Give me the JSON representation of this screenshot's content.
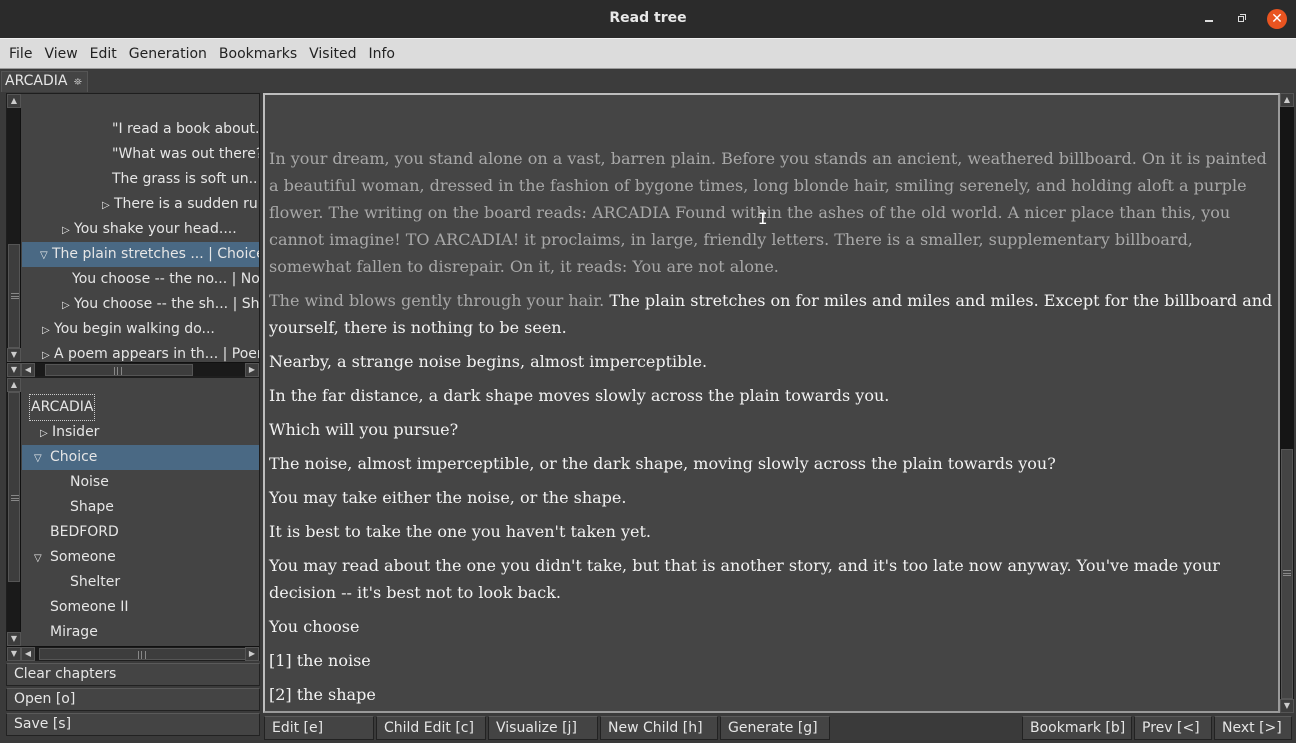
{
  "window": {
    "title": "Read tree",
    "controls": [
      "minimize-icon",
      "maximize-icon",
      "close-icon"
    ]
  },
  "menubar": {
    "items": [
      "File",
      "View",
      "Edit",
      "Generation",
      "Bookmarks",
      "Visited",
      "Info"
    ]
  },
  "tabs": [
    {
      "label": "ARCADIA",
      "close_glyph": "⛯"
    }
  ],
  "chapter_tree": {
    "rows": [
      {
        "label": "\"I read a book about...",
        "expander": "none"
      },
      {
        "label": "\"What was out there?...",
        "expander": "none"
      },
      {
        "label": "The grass is soft un...",
        "expander": "none"
      },
      {
        "label": "There is a sudden ru...",
        "expander": "collapsed"
      },
      {
        "label": "You shake your head....",
        "expander": "collapsed"
      },
      {
        "label": "The plain stretches ... | Choice",
        "expander": "expanded",
        "selected": true
      },
      {
        "label": "You choose -- the no... | Noise",
        "expander": "none"
      },
      {
        "label": "You choose -- the sh... | Shape",
        "expander": "collapsed"
      },
      {
        "label": "You begin walking do...",
        "expander": "collapsed"
      },
      {
        "label": "A poem appears in th... | Poem",
        "expander": "collapsed"
      }
    ]
  },
  "bookmark_tree": {
    "rows": [
      {
        "label": "ARCADIA",
        "expander": "root",
        "focused": true
      },
      {
        "label": "Insider",
        "expander": "collapsed"
      },
      {
        "label": "Choice",
        "expander": "expanded",
        "selected": true
      },
      {
        "label": "Noise",
        "expander": "none"
      },
      {
        "label": "Shape",
        "expander": "none"
      },
      {
        "label": "BEDFORD",
        "expander": "none"
      },
      {
        "label": "Someone",
        "expander": "expanded"
      },
      {
        "label": "Shelter",
        "expander": "none"
      },
      {
        "label": "Someone II",
        "expander": "none"
      },
      {
        "label": "Mirage",
        "expander": "none"
      }
    ]
  },
  "side_buttons": {
    "clear": "Clear chapters",
    "open": "Open [o]",
    "save": "Save [s]"
  },
  "story": {
    "history_paragraph": "In your dream, you stand alone on a vast, barren plain. Before you stands an ancient, weathered billboard. On it is painted a beautiful woman, dressed in the fashion of bygone times, long blonde hair, smiling serenely, and holding aloft a purple flower. The writing on the board reads: ARCADIA Found within the ashes of the old world. A nicer place than this, you cannot imagine! TO ARCADIA! it proclaims, in large, friendly letters. There is a smaller, supplementary billboard, somewhat fallen to disrepair. On it, it reads: You are not alone.",
    "transition_dim": "The wind blows gently through your hair. ",
    "transition_bright": "The plain stretches on for miles and miles and miles. Except for the billboard and yourself, there is nothing to be seen.",
    "paragraphs": [
      "Nearby, a strange noise begins, almost imperceptible.",
      "In the far distance, a dark shape moves slowly across the plain towards you.",
      "Which will you pursue?",
      "The noise, almost imperceptible, or the dark shape, moving slowly across the plain towards you?",
      "You may take either the noise, or the shape.",
      "It is best to take the one you haven't taken yet.",
      "You may read about the one you didn't take, but that is another story, and it's too late now anyway. You've made your decision -- it's best not to look back.",
      "You choose",
      "[1] the noise",
      "[2] the shape"
    ]
  },
  "bottom_toolbar": {
    "edit": "Edit [e]",
    "child_edit": "Child Edit [c]",
    "visualize": "Visualize [j]",
    "new_child": "New Child [h]",
    "generate": "Generate [g]",
    "bookmark": "Bookmark [b]",
    "prev": "Prev [<]",
    "next": "Next [>]"
  },
  "colors": {
    "selection": "#4a6984",
    "close_button": "#e95420",
    "text_bright": "#f2f2f2",
    "text_dim": "#a8a8a8",
    "panel_bg": "#454545"
  }
}
